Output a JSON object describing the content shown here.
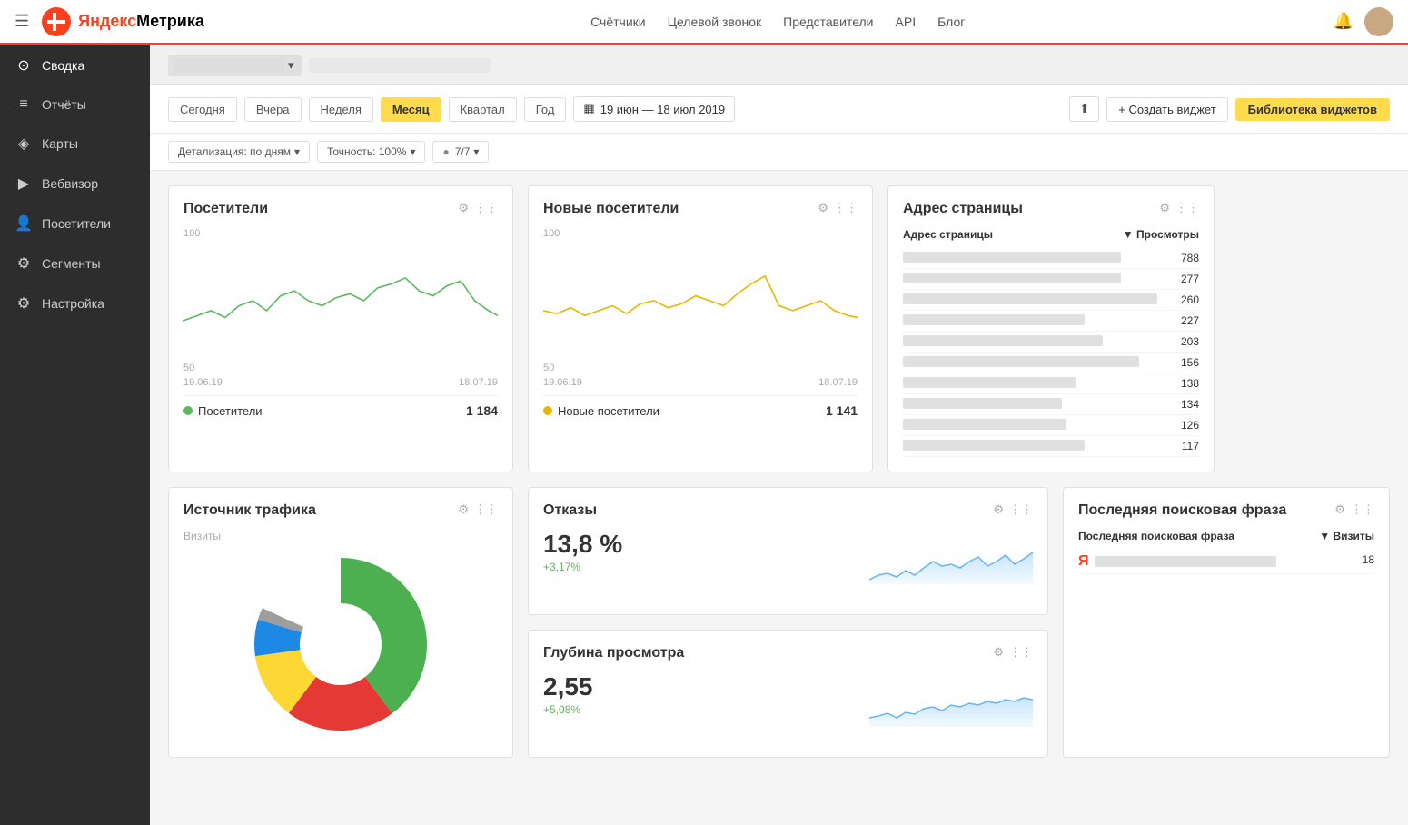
{
  "topnav": {
    "hamburger": "☰",
    "logo_red": "Яндекс",
    "logo_black": " Метрика",
    "nav_links": [
      "Счётчики",
      "Целевой звонок",
      "Представители",
      "API",
      "Блог"
    ]
  },
  "sidebar": {
    "items": [
      {
        "id": "svodka",
        "label": "Сводка",
        "icon": "⊙",
        "active": true
      },
      {
        "id": "otchety",
        "label": "Отчёты",
        "icon": "📊"
      },
      {
        "id": "karty",
        "label": "Карты",
        "icon": "🗺"
      },
      {
        "id": "vebvizor",
        "label": "Вебвизор",
        "icon": "▶"
      },
      {
        "id": "posetiteli",
        "label": "Посетители",
        "icon": "👤"
      },
      {
        "id": "segmenty",
        "label": "Сегменты",
        "icon": "⚙"
      },
      {
        "id": "nastrojka",
        "label": "Настройка",
        "icon": "⚙"
      }
    ]
  },
  "toolbar": {
    "periods": [
      "Сегодня",
      "Вчера",
      "Неделя",
      "Месяц",
      "Квартал",
      "Год"
    ],
    "active_period": "Месяц",
    "date_range": "19 июн — 18 июл 2019",
    "calendar_icon": "📅",
    "export_icon": "⬆",
    "create_widget": "+ Создать виджет",
    "library_btn": "Библиотека виджетов",
    "detail_label": "Детализация: по дням",
    "accuracy_label": "Точность: 100%",
    "segments_label": "7/7"
  },
  "visitors_card": {
    "title": "Посетители",
    "date_start": "19.06.19",
    "date_end": "18.07.19",
    "legend_label": "Посетители",
    "legend_value": "1 184",
    "color": "#5cb85c",
    "y_max": "100",
    "y_mid": "50"
  },
  "new_visitors_card": {
    "title": "Новые посетители",
    "date_start": "19.06.19",
    "date_end": "18.07.19",
    "legend_label": "Новые посетители",
    "legend_value": "1 141",
    "color": "#e6b800",
    "y_max": "100",
    "y_mid": "50"
  },
  "traffic_card": {
    "title": "Источник трафика",
    "subtitle": "Визиты"
  },
  "bounce_card": {
    "title": "Отказы",
    "value": "13,8 %",
    "delta": "+3,17%"
  },
  "depth_card": {
    "title": "Глубина просмотра",
    "value": "2,55",
    "delta": "+5,08%"
  },
  "address_card": {
    "title": "Адрес страницы",
    "col1": "Адрес страницы",
    "col2": "▼ Просмотры",
    "rows": [
      {
        "value": 788
      },
      {
        "value": 277
      },
      {
        "value": 260
      },
      {
        "value": 227
      },
      {
        "value": 203
      },
      {
        "value": 156
      },
      {
        "value": 138
      },
      {
        "value": 134
      },
      {
        "value": 126
      },
      {
        "value": 117
      }
    ]
  },
  "search_card": {
    "title": "Последняя поисковая фраза",
    "col1": "Последняя поисковая фраза",
    "col2": "▼ Визиты",
    "ya_icon": "Я",
    "ya_value": "18"
  },
  "icons": {
    "gear": "⚙",
    "grid": "⋮⋮",
    "chevron_down": "▾",
    "calendar": "▦"
  }
}
